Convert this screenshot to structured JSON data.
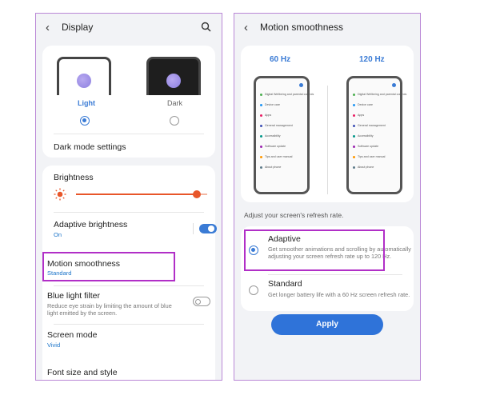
{
  "left": {
    "header": {
      "title": "Display"
    },
    "theme": {
      "light_label": "Light",
      "dark_label": "Dark",
      "selected": "light"
    },
    "dark_mode_settings": "Dark mode settings",
    "brightness": {
      "label": "Brightness",
      "level": 0.92
    },
    "adaptive_brightness": {
      "label": "Adaptive brightness",
      "value": "On"
    },
    "motion_smoothness": {
      "label": "Motion smoothness",
      "value": "Standard"
    },
    "blue_light": {
      "label": "Blue light filter",
      "desc": "Reduce eye strain by limiting the amount of blue light emitted by the screen."
    },
    "screen_mode": {
      "label": "Screen mode",
      "value": "Vivid"
    },
    "font_size": {
      "label": "Font size and style"
    }
  },
  "right": {
    "header": {
      "title": "Motion smoothness"
    },
    "hz60": "60 Hz",
    "hz120": "120 Hz",
    "mock_items": [
      "Digital Wellbeing and parental controls",
      "Device care",
      "Apps",
      "General management",
      "Accessibility",
      "Software update",
      "Tips and user manual",
      "About phone"
    ],
    "instruction": "Adjust your screen's refresh rate.",
    "adaptive": {
      "label": "Adaptive",
      "desc": "Get smoother animations and scrolling by automatically adjusting your screen refresh rate up to 120 Hz.",
      "selected": true
    },
    "standard": {
      "label": "Standard",
      "desc": "Get longer battery life with a 60 Hz screen refresh rate.",
      "selected": false
    },
    "apply": "Apply"
  },
  "colors": {
    "accent": "#3a7bd5",
    "slider": "#e8562a",
    "highlight": "#b12fc7"
  }
}
